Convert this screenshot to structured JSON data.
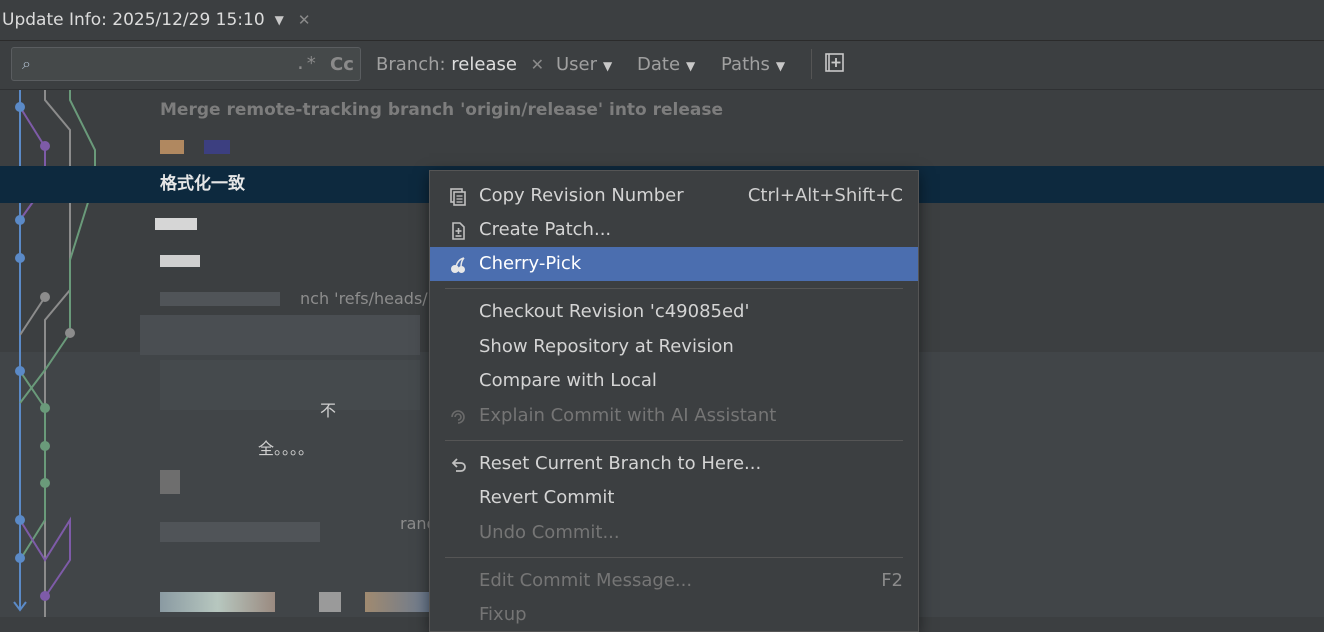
{
  "window": {
    "title": "Update Info: 2025/12/29 15:10"
  },
  "toolbar": {
    "search_placeholder": "",
    "regex_label": ".*",
    "case_label": "Cc",
    "branch_prefix": "Branch:",
    "branch_value": "release",
    "user_label": "User",
    "date_label": "Date",
    "paths_label": "Paths"
  },
  "log": {
    "commits": [
      "Merge remote-tracking branch 'origin/release' into release",
      "格式化一致",
      "nch 'refs/heads/rel",
      "不",
      "全。。。。",
      "rand"
    ]
  },
  "context_menu": {
    "items": [
      {
        "label": "Copy Revision Number",
        "shortcut": "Ctrl+Alt+Shift+C",
        "icon": "copy-icon",
        "enabled": true
      },
      {
        "label": "Create Patch...",
        "icon": "patch-icon",
        "enabled": true
      },
      {
        "label": "Cherry-Pick",
        "icon": "cherry-icon",
        "enabled": true,
        "highlighted": true
      },
      {
        "label": "Checkout Revision 'c49085ed'",
        "enabled": true
      },
      {
        "label": "Show Repository at Revision",
        "enabled": true
      },
      {
        "label": "Compare with Local",
        "enabled": true
      },
      {
        "label": "Explain Commit with AI Assistant",
        "icon": "ai-assistant-icon",
        "enabled": false
      },
      {
        "label": "Reset Current Branch to Here...",
        "icon": "undo-icon",
        "enabled": true
      },
      {
        "label": "Revert Commit",
        "enabled": true
      },
      {
        "label": "Undo Commit...",
        "enabled": false
      },
      {
        "label": "Edit Commit Message...",
        "shortcut": "F2",
        "enabled": false
      },
      {
        "label": "Fixup",
        "enabled": false
      }
    ]
  },
  "colors": {
    "background": "#3c3f41",
    "selected_row": "#0d293e",
    "menu_highlight": "#4b6eaf",
    "graph_blue": "#5b8ac7",
    "graph_purple": "#7e5ba8",
    "graph_green": "#6a9a7a",
    "graph_gray": "#8c8c8c"
  }
}
